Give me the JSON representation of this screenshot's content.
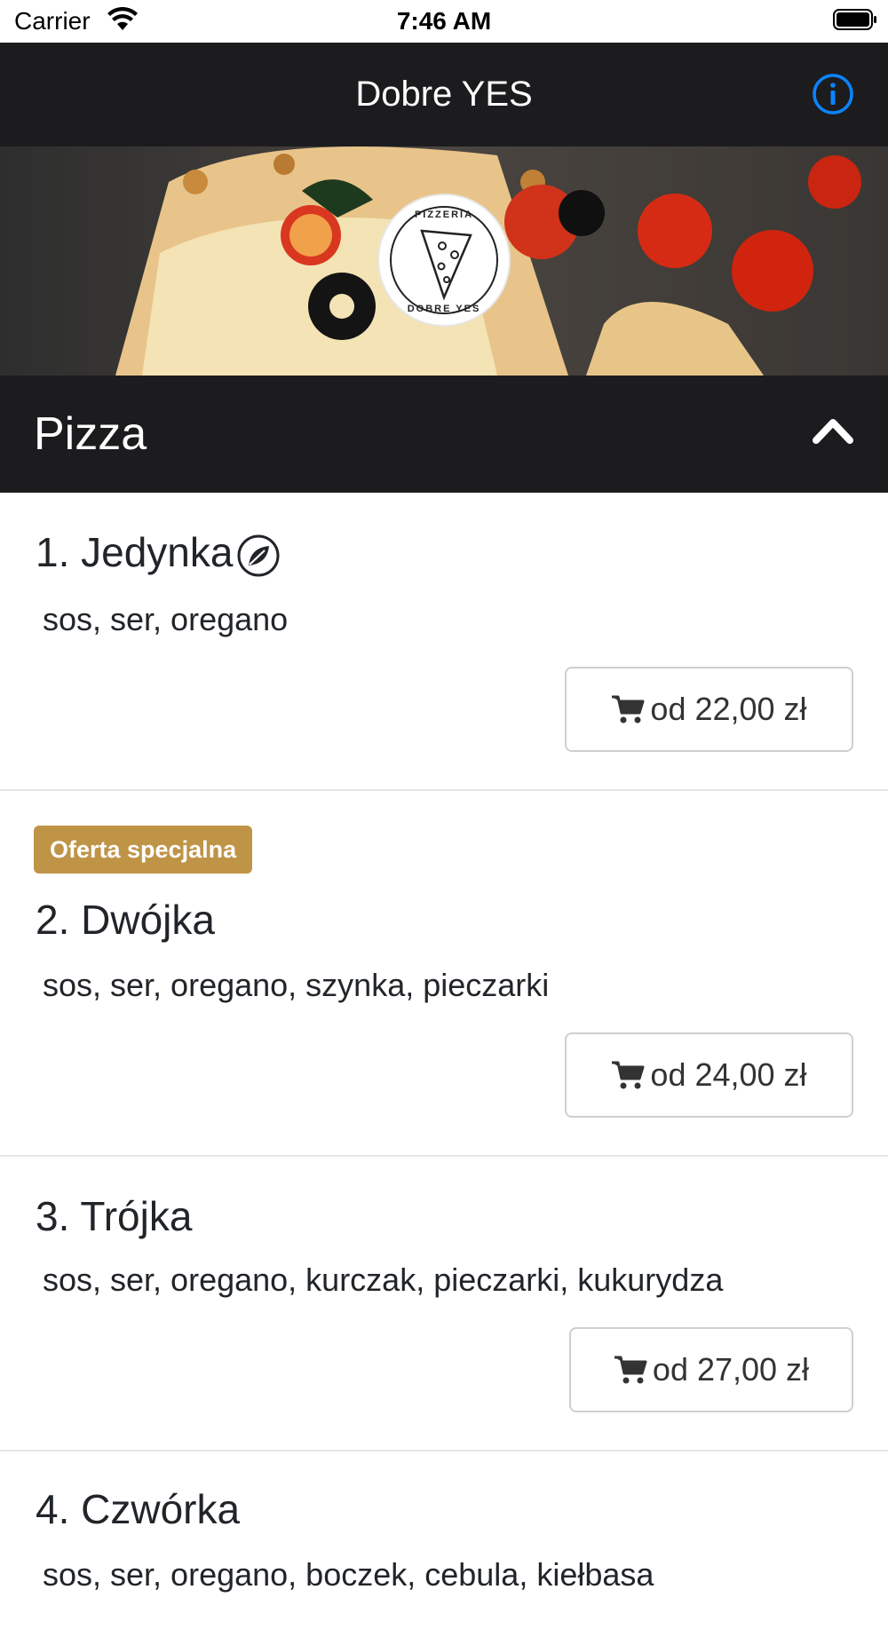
{
  "status_bar": {
    "carrier": "Carrier",
    "time": "7:46 AM"
  },
  "nav": {
    "title": "Dobre YES",
    "info_icon": "info-circle-icon"
  },
  "hero": {
    "logo_text_top": "PIZZERIA",
    "logo_text_bottom": "DOBRE YES"
  },
  "section": {
    "title": "Pizza",
    "toggle_icon": "chevron-up-icon"
  },
  "items": [
    {
      "name": "1. Jedynka",
      "description": "sos, ser, oregano",
      "price": "od 22,00 zł",
      "vegetarian": true,
      "badge": ""
    },
    {
      "name": "2. Dwójka",
      "description": "sos, ser, oregano, szynka, pieczarki",
      "price": "od 24,00 zł",
      "vegetarian": false,
      "badge": "Oferta specjalna"
    },
    {
      "name": "3. Trójka",
      "description": "sos, ser, oregano, kurczak, pieczarki, kukurydza",
      "price": "od 27,00 zł",
      "vegetarian": false,
      "badge": ""
    },
    {
      "name": "4. Czwórka",
      "description": "sos, ser, oregano, boczek, cebula, kiełbasa",
      "price": "",
      "vegetarian": false,
      "badge": ""
    }
  ],
  "colors": {
    "navbar": "#1c1c1e",
    "accent": "#0a84ff",
    "badge": "#bf9447"
  }
}
